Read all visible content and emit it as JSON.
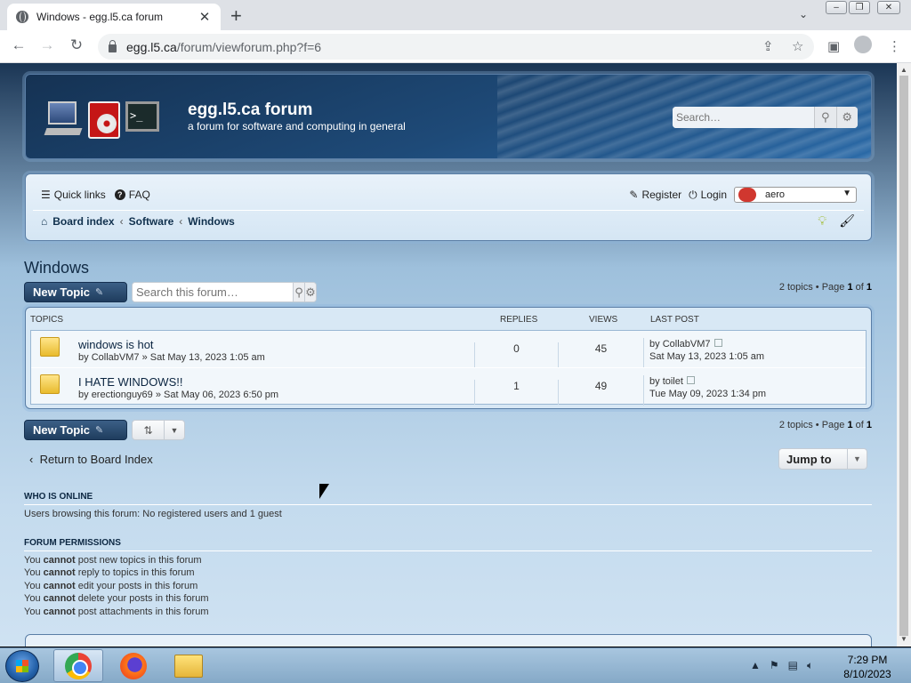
{
  "browser": {
    "tab_title": "Windows - egg.l5.ca forum",
    "tab_close": "✕",
    "new_tab": "+",
    "tabs_menu": "⌄",
    "url_host": "egg.l5.ca",
    "url_path": "/forum/viewforum.php?f=6"
  },
  "header": {
    "site_title": "egg.l5.ca forum",
    "site_desc": "a forum for software and computing in general",
    "search_placeholder": "Search…"
  },
  "navbar": {
    "quick_links": "Quick links",
    "faq": "FAQ",
    "register": "Register",
    "login": "Login",
    "theme": "aero",
    "breadcrumbs": [
      "Board index",
      "Software",
      "Windows"
    ]
  },
  "forum": {
    "title": "Windows",
    "new_topic": "New Topic",
    "search_placeholder": "Search this forum…",
    "pagination_prefix": "2 topics • Page ",
    "page_current": "1",
    "page_of": " of ",
    "page_total": "1",
    "headers": {
      "topics": "Topics",
      "replies": "Replies",
      "views": "Views",
      "last_post": "Last post"
    },
    "topics": [
      {
        "title": "windows is hot",
        "author": "CollabVM7",
        "date": "Sat May 13, 2023 1:05 am",
        "replies": "0",
        "views": "45",
        "last_by": "CollabVM7",
        "last_date": "Sat May 13, 2023 1:05 am"
      },
      {
        "title": "I HATE WINDOWS!!",
        "author": "erectionguy69",
        "date": "Sat May 06, 2023 6:50 pm",
        "replies": "1",
        "views": "49",
        "last_by": "toilet",
        "last_date": "Tue May 09, 2023 1:34 pm"
      }
    ],
    "by_label": "by",
    "raquo": "»",
    "return_label": "Return to Board Index",
    "jump_to": "Jump to"
  },
  "online": {
    "heading": "Who is online",
    "text": "Users browsing this forum: No registered users and 1 guest"
  },
  "permissions": {
    "heading": "Forum permissions",
    "you": "You",
    "cannot": "cannot",
    "lines": [
      "post new topics in this forum",
      "reply to topics in this forum",
      "edit your posts in this forum",
      "delete your posts in this forum",
      "post attachments in this forum"
    ]
  },
  "taskbar": {
    "time": "7:29 PM",
    "date": "8/10/2023"
  }
}
